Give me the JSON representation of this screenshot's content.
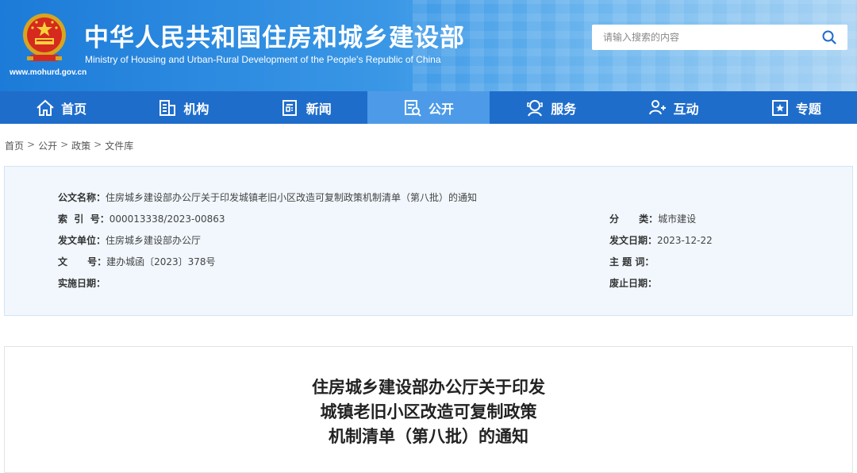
{
  "header": {
    "title_cn": "中华人民共和国住房和城乡建设部",
    "title_en": "Ministry of Housing and Urban-Rural Development of the People's Republic of China",
    "url": "www.mohurd.gov.cn",
    "search_placeholder": "请输入搜索的内容"
  },
  "nav": {
    "items": [
      {
        "label": "首页",
        "icon": "home-icon"
      },
      {
        "label": "机构",
        "icon": "building-icon"
      },
      {
        "label": "新闻",
        "icon": "news-icon"
      },
      {
        "label": "公开",
        "icon": "disclosure-icon",
        "active": true
      },
      {
        "label": "服务",
        "icon": "service-icon"
      },
      {
        "label": "互动",
        "icon": "interaction-icon"
      },
      {
        "label": "专题",
        "icon": "topic-icon"
      }
    ]
  },
  "breadcrumb": {
    "items": [
      "首页",
      "公开",
      "政策",
      "文件库"
    ],
    "separator": ">"
  },
  "meta": {
    "doc_name_label": "公文名称：",
    "doc_name": "住房城乡建设部办公厅关于印发城镇老旧小区改造可复制政策机制清单（第八批）的通知",
    "index_label": "索  引  号：",
    "index": "000013338/2023-00863",
    "category_label": "分        类：",
    "category": "城市建设",
    "issuer_label": "发文单位：",
    "issuer": "住房城乡建设部办公厅",
    "issue_date_label": "发文日期：",
    "issue_date": "2023-12-22",
    "doc_no_label": "文        号：",
    "doc_no": "建办城函〔2023〕378号",
    "keywords_label": "主  题  词：",
    "keywords": "",
    "effective_label": "实施日期：",
    "effective": "",
    "expiry_label": "废止日期：",
    "expiry": ""
  },
  "article": {
    "title_lines": [
      "住房城乡建设部办公厅关于印发",
      "城镇老旧小区改造可复制政策",
      "机制清单（第八批）的通知"
    ]
  },
  "colors": {
    "nav_bg": "#1f6dcb",
    "nav_active": "#4d9be8",
    "meta_bg": "#f1f7fd"
  }
}
